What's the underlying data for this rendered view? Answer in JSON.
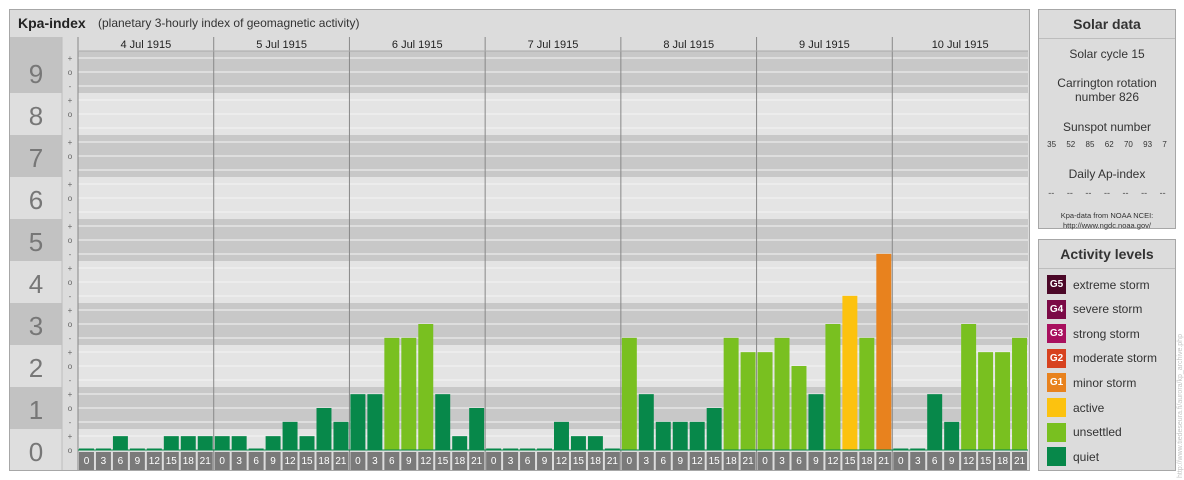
{
  "header": {
    "title": "Kpa-index",
    "subtitle": "(planetary 3-hourly index of geomagnetic activity)"
  },
  "solar_data": {
    "title": "Solar data",
    "solar_cycle": "Solar cycle 15",
    "carrington_line1": "Carrington rotation",
    "carrington_line2": "number 826",
    "sunspot_title": "Sunspot number",
    "sunspot_values": [
      "35",
      "52",
      "85",
      "62",
      "70",
      "93",
      "7"
    ],
    "ap_title": "Daily Ap-index",
    "ap_values": [
      "--",
      "--",
      "--",
      "--",
      "--",
      "--",
      "--"
    ],
    "source_line1": "Kpa-data from NOAA NCEI:",
    "source_line2": "http://www.ngdc.noaa.gov/"
  },
  "activity_levels": {
    "title": "Activity levels",
    "items": [
      {
        "code": "G5",
        "label": "extreme storm",
        "color": "#4b0828"
      },
      {
        "code": "G4",
        "label": "severe storm",
        "color": "#7b0a46"
      },
      {
        "code": "G3",
        "label": "strong storm",
        "color": "#a8105e"
      },
      {
        "code": "G2",
        "label": "moderate storm",
        "color": "#d7421f"
      },
      {
        "code": "G1",
        "label": "minor storm",
        "color": "#e8821e"
      },
      {
        "code": "",
        "label": "active",
        "color": "#fcc20f"
      },
      {
        "code": "",
        "label": "unsettled",
        "color": "#79c020"
      },
      {
        "code": "",
        "label": "quiet",
        "color": "#07884a"
      }
    ]
  },
  "side_credit": "http://www.tiedeseura.fi/aurora/kp_archive.php",
  "chart_data": {
    "type": "bar",
    "title": "Kpa-index",
    "ylabel": "",
    "ylim": [
      0,
      9
    ],
    "y_ticks": [
      "0",
      "1",
      "2",
      "3",
      "4",
      "5",
      "6",
      "7",
      "8",
      "9"
    ],
    "sub_ticks": [
      "o",
      "+",
      "-"
    ],
    "days": [
      "4 Jul 1915",
      "5 Jul 1915",
      "6 Jul 1915",
      "7 Jul 1915",
      "8 Jul 1915",
      "9 Jul 1915",
      "10 Jul 1915"
    ],
    "hour_labels": [
      [
        "0",
        "3"
      ],
      [
        "3",
        "6"
      ],
      [
        "6",
        "9"
      ],
      [
        "9",
        "12"
      ],
      [
        "12",
        "15"
      ],
      [
        "15",
        "18"
      ],
      [
        "18",
        "21"
      ],
      [
        "21",
        "24"
      ]
    ],
    "colors": {
      "quiet": "#07884a",
      "unsettled": "#79c020",
      "active": "#fcc20f",
      "minor_storm": "#e8821e"
    },
    "series": [
      {
        "values": [
          0,
          0,
          0.33,
          0,
          0,
          0.33,
          0.33,
          0.33
        ]
      },
      {
        "values": [
          0.33,
          0.33,
          0,
          0.33,
          0.67,
          0.33,
          1,
          0.67
        ]
      },
      {
        "values": [
          1.33,
          1.33,
          2.67,
          2.67,
          3,
          1.33,
          0.33,
          1
        ]
      },
      {
        "values": [
          0,
          0,
          0,
          0,
          0.67,
          0.33,
          0.33,
          0
        ]
      },
      {
        "values": [
          2.67,
          1.33,
          0.67,
          0.67,
          0.67,
          1,
          2.67,
          2.33
        ]
      },
      {
        "values": [
          2.33,
          2.67,
          2,
          1.33,
          3,
          3.67,
          2.67,
          4.67
        ]
      },
      {
        "values": [
          0,
          0,
          1.33,
          0.67,
          3,
          2.33,
          2.33,
          2.67
        ]
      }
    ]
  }
}
